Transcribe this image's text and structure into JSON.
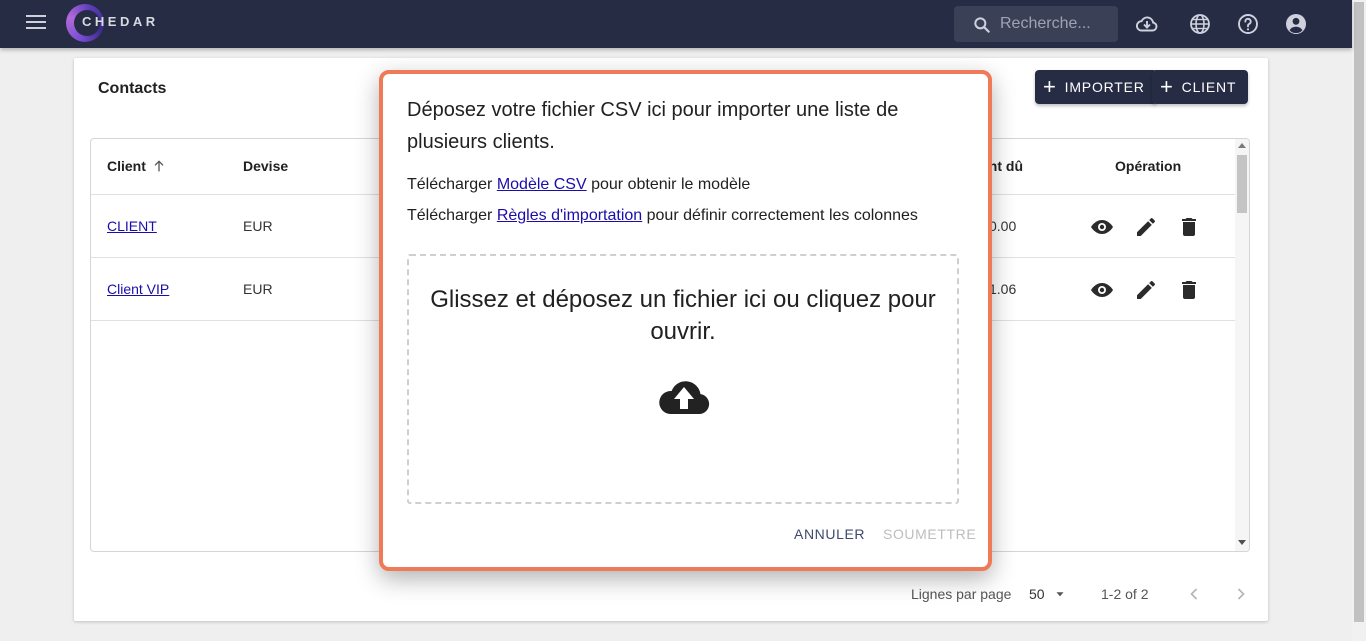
{
  "appbar": {
    "logo_text": "CHEDAR",
    "search_placeholder": "Recherche...",
    "icons": [
      "menu-icon",
      "search-icon",
      "cloud-download-icon",
      "globe-icon",
      "help-icon",
      "account-icon"
    ]
  },
  "card": {
    "title": "Contacts",
    "import_button": "IMPORTER",
    "client_button": "CLIENT"
  },
  "table": {
    "headers": {
      "client": "Client",
      "devise": "Devise",
      "montant_du": "ant dû",
      "operation": "Opération"
    },
    "rows": [
      {
        "client": "CLIENT",
        "devise": "EUR",
        "montant": "0.00"
      },
      {
        "client": "Client VIP",
        "devise": "EUR",
        "montant": "1.06"
      }
    ]
  },
  "pagination": {
    "rows_per_page_label": "Lignes par page",
    "rows_per_page_value": "50",
    "range": "1-2 of 2"
  },
  "dialog": {
    "title": "Déposez votre fichier CSV ici pour importer une liste de plusieurs clients.",
    "line1_prefix": "Télécharger ",
    "line1_link": "Modèle CSV",
    "line1_suffix": " pour obtenir le modèle",
    "line2_prefix": "Télécharger ",
    "line2_link": "Règles d'importation",
    "line2_suffix": " pour définir correctement les colonnes",
    "dropzone_text": "Glissez et déposez un fichier ici ou cliquez pour ouvrir.",
    "cancel": "ANNULER",
    "submit": "SOUMETTRE"
  },
  "colors": {
    "appbar": "#252c43",
    "dialog_border": "#ee7a57",
    "link": "#1a0dab",
    "cancel_text": "#3d4a6b",
    "submit_disabled": "#bdbdbd"
  }
}
